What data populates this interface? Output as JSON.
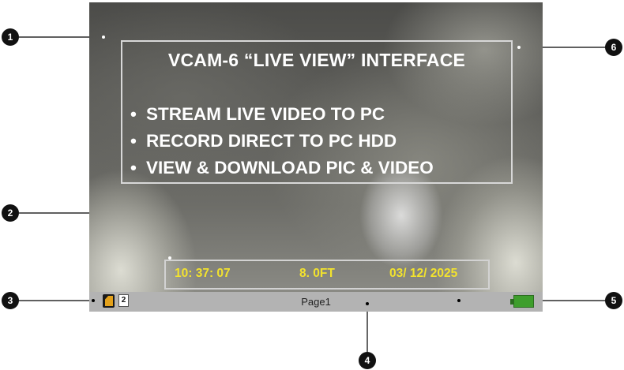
{
  "overlay": {
    "title": "VCAM-6 “LIVE VIEW” INTERFACE",
    "bullets": [
      "STREAM LIVE VIDEO TO PC",
      "RECORD DIRECT TO PC HDD",
      "VIEW & DOWNLOAD PIC & VIDEO"
    ]
  },
  "info_bar": {
    "time": "10: 37: 07",
    "distance": "8. 0FT",
    "date": "03/ 12/ 2025"
  },
  "status_bar": {
    "page_number": "2",
    "page_label": "Page1",
    "battery_color": "#3e9e2c"
  },
  "callouts": [
    "1",
    "2",
    "3",
    "4",
    "5",
    "6"
  ]
}
